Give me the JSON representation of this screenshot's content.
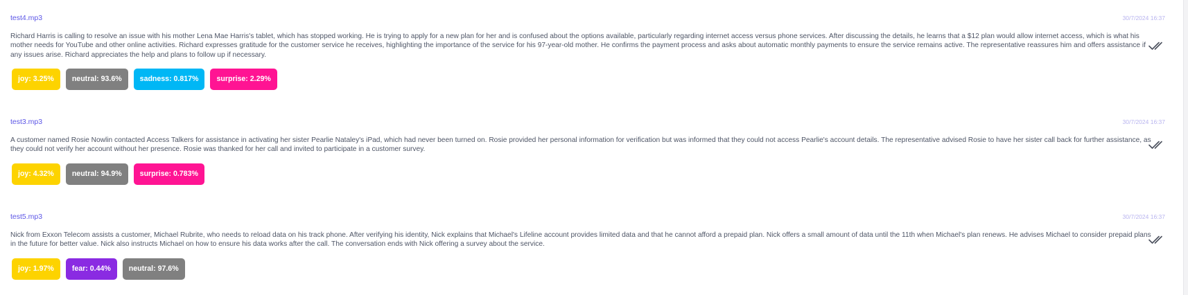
{
  "colors": {
    "joy": "#fdd300",
    "neutral": "#808080",
    "sadness": "#00b7f5",
    "surprise": "#ff1493",
    "fear": "#8a2be2",
    "filename": "#5b55e6",
    "timestamp": "#b8b4ef"
  },
  "entries": [
    {
      "file": "test4.mp3",
      "timestamp": "30/7/2024 16:37",
      "summary": "Richard Harris is calling to resolve an issue with his mother Lena Mae Harris's tablet, which has stopped working. He is trying to apply for a new plan for her and is confused about the options available, particularly regarding internet access versus phone services. After discussing the details, he learns that a $12 plan would allow internet access, which is what his mother needs for YouTube and other online activities. Richard expresses gratitude for the customer service he receives, highlighting the importance of the service for his 97-year-old mother. He confirms the payment process and asks about automatic monthly payments to ensure the service remains active. The representative reassures him and offers assistance if any issues arise. Richard appreciates the help and plans to follow up if necessary.",
      "status_icon": "double-check-icon",
      "emotions": [
        {
          "label": "joy: 3.25%",
          "emotion": "joy",
          "value": 3.25
        },
        {
          "label": "neutral: 93.6%",
          "emotion": "neutral",
          "value": 93.6
        },
        {
          "label": "sadness: 0.817%",
          "emotion": "sadness",
          "value": 0.817
        },
        {
          "label": "surprise: 2.29%",
          "emotion": "surprise",
          "value": 2.29
        }
      ]
    },
    {
      "file": "test3.mp3",
      "timestamp": "30/7/2024 16:37",
      "summary": "A customer named Rosie Nowlin contacted Access Talkers for assistance in activating her sister Pearlie Nataley's iPad, which had never been turned on. Rosie provided her personal information for verification but was informed that they could not access Pearlie's account details. The representative advised Rosie to have her sister call back for further assistance, as they could not verify her account without her presence. Rosie was thanked for her call and invited to participate in a customer survey.",
      "status_icon": "double-check-icon",
      "emotions": [
        {
          "label": "joy: 4.32%",
          "emotion": "joy",
          "value": 4.32
        },
        {
          "label": "neutral: 94.9%",
          "emotion": "neutral",
          "value": 94.9
        },
        {
          "label": "surprise: 0.783%",
          "emotion": "surprise",
          "value": 0.783
        }
      ]
    },
    {
      "file": "test5.mp3",
      "timestamp": "30/7/2024 16:37",
      "summary": "Nick from Exxon Telecom assists a customer, Michael Rubrite, who needs to reload data on his track phone. After verifying his identity, Nick explains that Michael's Lifeline account provides limited data and that he cannot afford a prepaid plan. Nick offers a small amount of data until the 11th when Michael's plan renews. He advises Michael to consider prepaid plans in the future for better value. Nick also instructs Michael on how to ensure his data works after the call. The conversation ends with Nick offering a survey about the service.",
      "status_icon": "double-check-icon",
      "emotions": [
        {
          "label": "joy: 1.97%",
          "emotion": "joy",
          "value": 1.97
        },
        {
          "label": "fear: 0.44%",
          "emotion": "fear",
          "value": 0.44
        },
        {
          "label": "neutral: 97.6%",
          "emotion": "neutral",
          "value": 97.6
        }
      ]
    }
  ]
}
